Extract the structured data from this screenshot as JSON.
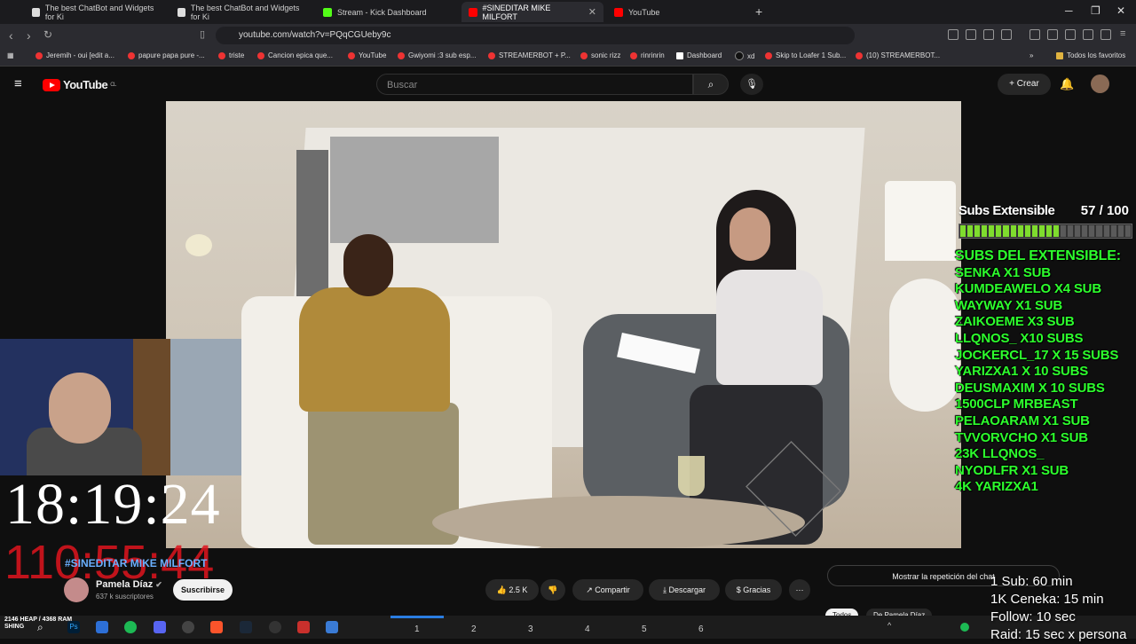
{
  "browser": {
    "tabs": [
      {
        "label": "The best ChatBot and Widgets for Ki",
        "active": false
      },
      {
        "label": "The best ChatBot and Widgets for Ki",
        "active": false
      },
      {
        "label": "Stream - Kick Dashboard",
        "active": false
      },
      {
        "label": "#SINEDITAR MIKE MILFORT",
        "active": true
      },
      {
        "label": "YouTube",
        "active": false
      }
    ],
    "url": "youtube.com/watch?v=PQqCGUeby9c",
    "bookmarks": [
      "Jeremih - oui [edit a...",
      "papure papa pure -...",
      "triste",
      "Cancion epica que...",
      "YouTube",
      "Gwiyomi :3 sub esp...",
      "STREAMERBOT + P...",
      "sonic rizz",
      "rinrinrin",
      "Dashboard",
      "xd",
      "Skip to Loafer 1 Sub...",
      "(10) STREAMERBOT..."
    ],
    "bookmarks_folder": "Todos los favoritos"
  },
  "youtube": {
    "logo_text": "YouTube",
    "logo_country": "CL",
    "search_placeholder": "Buscar",
    "create_label": "Crear",
    "video_title": "#SINEDITAR MIKE MILFORT",
    "channel_name": "Pamela Díaz",
    "channel_subs": "637 k suscriptores",
    "subscribe_label": "Suscribirse",
    "likes": "2.5 K",
    "share_label": "Compartir",
    "download_label": "Descargar",
    "thanks_label": "Gracias",
    "replay_label": "Mostrar la repetición del chat",
    "filter_all": "Todos",
    "filter_from": "De Pamela Díaz"
  },
  "overlay": {
    "subs_title": "Subs Extensible",
    "subs_count": "57 / 100",
    "subs_progress": 0.57,
    "list_header": "SUBS DEL EXTENSIBLE:",
    "list": [
      "SENKA X1 SUB",
      "KUMDEAWELO X4 SUB",
      "WAYWAY X1 SUB",
      "ZAIKOEME X3 SUB",
      "LLQNOS_ X10 SUBS",
      "JOCKERCL_17 X 15 SUBS",
      "YARIZXA1 X 10 SUBS",
      "DEUSMAXIM X 10 SUBS",
      "1500CLP MRBEAST",
      "PELAOARAM X1 SUB",
      "TVVORVCHO X1 SUB",
      "23K LLQNOS_",
      "NYODLFR X1 SUB",
      "4K YARIZXA1"
    ],
    "clock": "18:19:24",
    "red_timer": "110:55:44",
    "rules": [
      "1 Sub: 60 min",
      "1K Ceneka: 15 min",
      "Follow: 10 sec",
      "Raid: 15 sec x persona"
    ]
  },
  "taskbar": {
    "heap_text": "2146 HEAP / 4368 RAM",
    "heap_sub": "SHING",
    "workspaces": [
      "1",
      "2",
      "3",
      "4",
      "5",
      "6"
    ]
  },
  "colors": {
    "accent_red": "#ff0000",
    "overlay_green": "#2dff2d",
    "timer_red": "#e0141e"
  }
}
